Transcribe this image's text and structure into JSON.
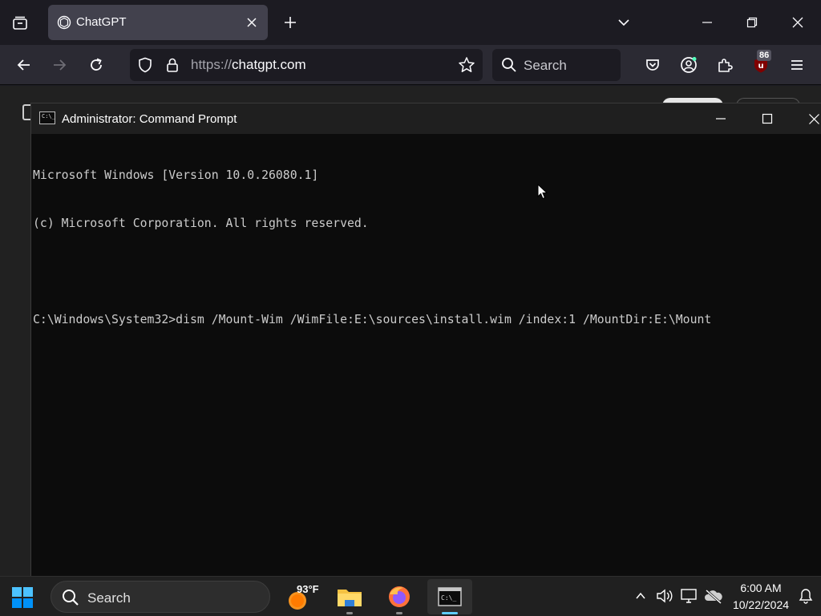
{
  "browser": {
    "tab": {
      "title": "ChatGPT"
    },
    "url": {
      "scheme": "https://",
      "host": "chatgpt.com"
    },
    "search": {
      "placeholder": "Search"
    },
    "extension_badge": "86"
  },
  "cmd": {
    "title": "Administrator: Command Prompt",
    "lines": [
      "Microsoft Windows [Version 10.0.26080.1]",
      "(c) Microsoft Corporation. All rights reserved.",
      "",
      "C:\\Windows\\System32>dism /Mount-Wim /WimFile:E:\\sources\\install.wim /index:1 /MountDir:E:\\Mount"
    ]
  },
  "taskbar": {
    "search_label": "Search",
    "weather_temp": "93°F",
    "apps": [
      "weather-icon",
      "file-explorer-icon",
      "firefox-icon",
      "terminal-icon"
    ],
    "clock": {
      "time": "6:00 AM",
      "date": "10/22/2024"
    }
  },
  "colors": {
    "cmd_bg": "#0c0c0c",
    "cmd_text": "#cccccc",
    "taskbar_bg": "#202020",
    "accent": "#60cdff"
  }
}
